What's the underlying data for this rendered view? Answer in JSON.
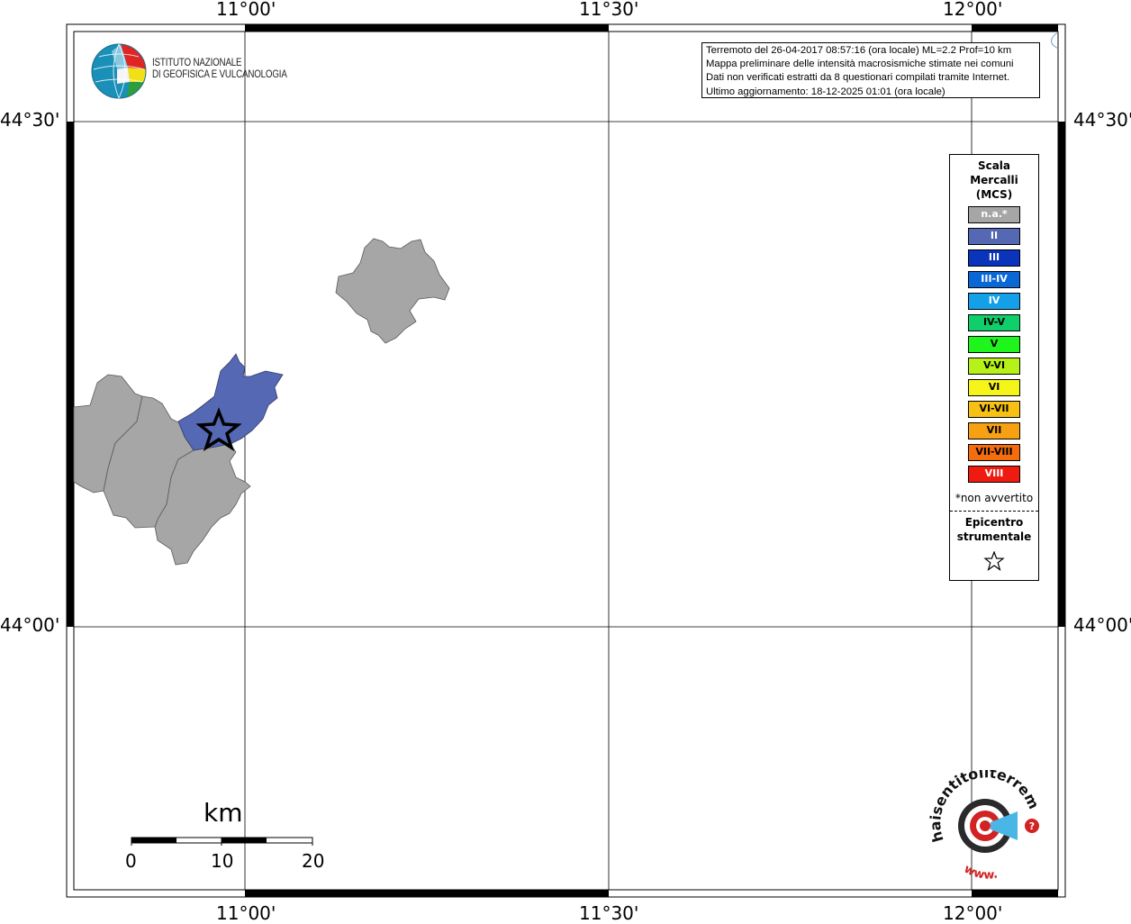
{
  "map": {
    "longitude_labels": [
      "11°00'",
      "11°30'",
      "12°00'"
    ],
    "latitude_labels": [
      "44°30'",
      "44°00'"
    ]
  },
  "institute": {
    "name_line1": "ISTITUTO NAZIONALE",
    "name_line2": "DI GEOFISICA E VULCANOLOGIA"
  },
  "info": {
    "line1": "Terremoto del 26-04-2017 08:57:16 (ora locale) ML=2.2 Prof=10 km",
    "line2": "Mappa preliminare delle intensità macrosismiche stimate nei comuni",
    "line3": "Dati non verificati estratti da 8 questionari compilati tramite Internet.",
    "line4": "Ultimo aggiornamento: 18-12-2025 01:01 (ora locale)"
  },
  "legend": {
    "title_line1": "Scala",
    "title_line2": "Mercalli",
    "title_line3": "(MCS)",
    "items": [
      {
        "label": "n.a.*",
        "color": "#a6a6a6",
        "text_color": "#ffffff"
      },
      {
        "label": "II",
        "color": "#5468b4",
        "text_color": "#ffffff"
      },
      {
        "label": "III",
        "color": "#0b34bd",
        "text_color": "#ffffff"
      },
      {
        "label": "III-IV",
        "color": "#0a67d6",
        "text_color": "#ffffff"
      },
      {
        "label": "IV",
        "color": "#14a0e8",
        "text_color": "#ffffff"
      },
      {
        "label": "IV-V",
        "color": "#0fcf6b",
        "text_color": "#000000"
      },
      {
        "label": "V",
        "color": "#1df51d",
        "text_color": "#000000"
      },
      {
        "label": "V-VI",
        "color": "#b6f21a",
        "text_color": "#000000"
      },
      {
        "label": "VI",
        "color": "#f6f51a",
        "text_color": "#000000"
      },
      {
        "label": "VI-VII",
        "color": "#f7c114",
        "text_color": "#000000"
      },
      {
        "label": "VII",
        "color": "#f7a012",
        "text_color": "#000000"
      },
      {
        "label": "VII-VIII",
        "color": "#f46c0e",
        "text_color": "#000000"
      },
      {
        "label": "VIII",
        "color": "#ef1b10",
        "text_color": "#ffffff"
      }
    ],
    "note": "*non avvertito",
    "epicentre_line1": "Epicentro",
    "epicentre_line2": "strumentale"
  },
  "scale": {
    "unit": "km",
    "labels": [
      "0",
      "10",
      "20"
    ]
  },
  "haisentito": {
    "text": "haisentitoilterremoto.it",
    "url": "www."
  }
}
